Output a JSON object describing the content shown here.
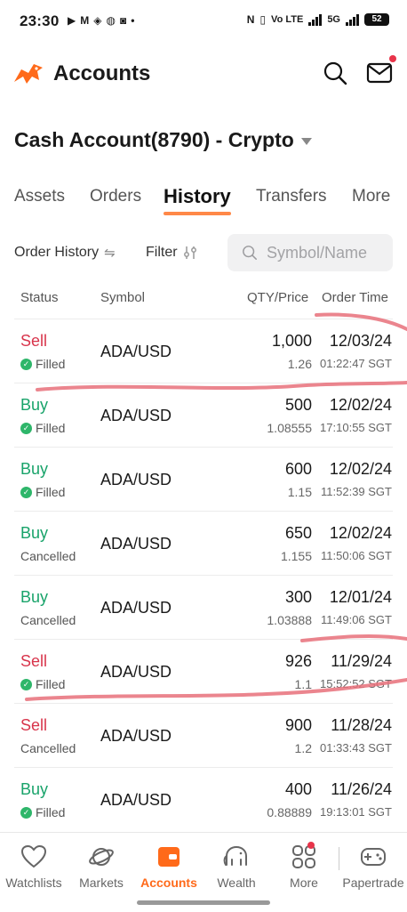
{
  "status_bar": {
    "time": "23:30",
    "left_icons": [
      "youtube-icon",
      "gmail-icon",
      "app-icon",
      "app-icon",
      "app-icon",
      "dot-icon"
    ],
    "network": "Vo LTE",
    "net_type": "5G",
    "battery": "52"
  },
  "header": {
    "title": "Accounts",
    "brand_color": "#ff6a1a"
  },
  "account": {
    "name": "Cash Account(8790) - Crypto"
  },
  "tabs": [
    {
      "label": "Assets"
    },
    {
      "label": "Orders"
    },
    {
      "label": "History"
    },
    {
      "label": "Transfers"
    },
    {
      "label": "More"
    }
  ],
  "filters": {
    "order_history_label": "Order History",
    "filter_label": "Filter",
    "search_placeholder": "Symbol/Name"
  },
  "columns": {
    "status": "Status",
    "symbol": "Symbol",
    "qty_price": "QTY/Price",
    "order_time": "Order Time"
  },
  "orders": [
    {
      "side": "Sell",
      "status": "Filled",
      "symbol": "ADA/USD",
      "qty": "1,000",
      "price": "1.26",
      "date": "12/03/24",
      "time": "01:22:47 SGT"
    },
    {
      "side": "Buy",
      "status": "Filled",
      "symbol": "ADA/USD",
      "qty": "500",
      "price": "1.08555",
      "date": "12/02/24",
      "time": "17:10:55 SGT"
    },
    {
      "side": "Buy",
      "status": "Filled",
      "symbol": "ADA/USD",
      "qty": "600",
      "price": "1.15",
      "date": "12/02/24",
      "time": "11:52:39 SGT"
    },
    {
      "side": "Buy",
      "status": "Cancelled",
      "symbol": "ADA/USD",
      "qty": "650",
      "price": "1.155",
      "date": "12/02/24",
      "time": "11:50:06 SGT"
    },
    {
      "side": "Buy",
      "status": "Cancelled",
      "symbol": "ADA/USD",
      "qty": "300",
      "price": "1.03888",
      "date": "12/01/24",
      "time": "11:49:06 SGT"
    },
    {
      "side": "Sell",
      "status": "Filled",
      "symbol": "ADA/USD",
      "qty": "926",
      "price": "1.1",
      "date": "11/29/24",
      "time": "15:52:52 SGT"
    },
    {
      "side": "Sell",
      "status": "Cancelled",
      "symbol": "ADA/USD",
      "qty": "900",
      "price": "1.2",
      "date": "11/28/24",
      "time": "01:33:43 SGT"
    },
    {
      "side": "Buy",
      "status": "Filled",
      "symbol": "ADA/USD",
      "qty": "400",
      "price": "0.88889",
      "date": "11/26/24",
      "time": "19:13:01 SGT"
    }
  ],
  "colors": {
    "sell": "#d8344b",
    "buy": "#18a36a",
    "filled_check": "#2eb66a",
    "annotation_stroke": "#e8707a"
  },
  "bottom_nav": [
    {
      "label": "Watchlists",
      "icon": "heart-icon"
    },
    {
      "label": "Markets",
      "icon": "planet-icon"
    },
    {
      "label": "Accounts",
      "icon": "wallet-icon"
    },
    {
      "label": "Wealth",
      "icon": "elephant-icon"
    },
    {
      "label": "More",
      "icon": "grid-icon"
    },
    {
      "label": "Papertrade",
      "icon": "gamepad-icon"
    }
  ]
}
